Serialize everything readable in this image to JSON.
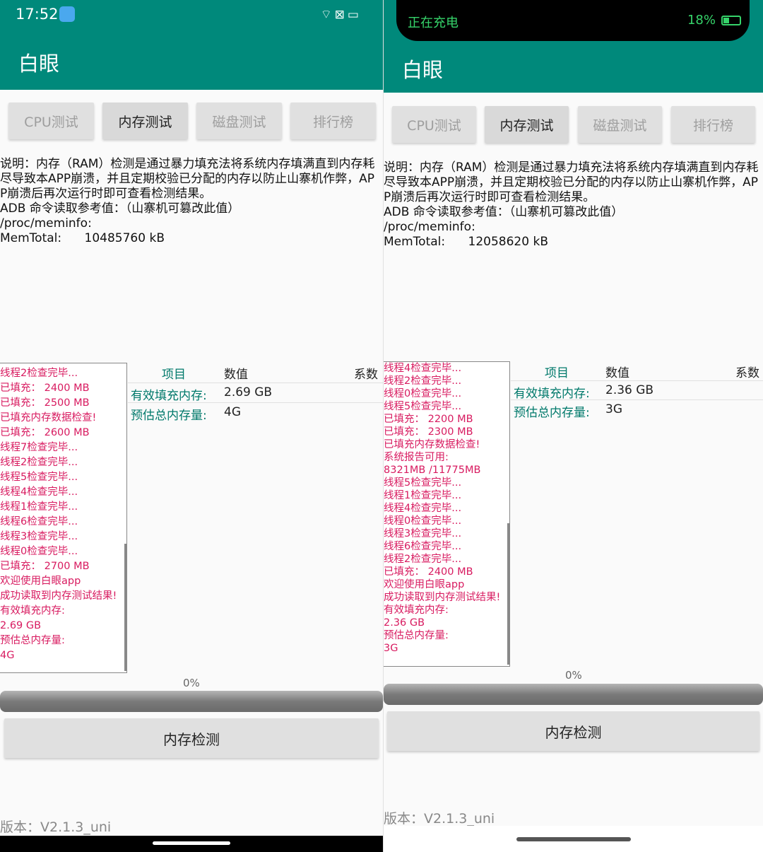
{
  "left": {
    "status": {
      "time": "17:52",
      "icons": "⌔⊠▭"
    },
    "app_title": "白眼",
    "tabs": [
      "CPU测试",
      "内存测试",
      "磁盘测试",
      "排行榜"
    ],
    "description": "说明：内存（RAM）检测是通过暴力填充法将系统内存填满直到内存耗尽导致本APP崩溃，并且定期校验已分配的内存以防止山寨机作弊，APP崩溃后再次运行时即可查看检测结果。\nADB 命令读取参考值：（山寨机可篡改此值）\n/proc/meminfo:\nMemTotal:      10485760 kB",
    "log": [
      "线程2检查完毕...",
      "已填充：  2400 MB",
      "已填充：  2500 MB",
      "已填充内存数据检查!",
      "已填充：  2600 MB",
      "线程7检查完毕...",
      "线程2检查完毕...",
      "线程5检查完毕...",
      "线程4检查完毕...",
      "线程1检查完毕...",
      "线程6检查完毕...",
      "线程3检查完毕...",
      "线程0检查完毕...",
      "已填充：  2700 MB",
      "欢迎使用白眼app",
      "成功读取到内存测试结果!",
      "有效填充内存:",
      "2.69 GB",
      "预估总内存量:",
      "4G"
    ],
    "table": {
      "headers": {
        "item": "项目",
        "value": "数值",
        "coef": "系数"
      },
      "rows": [
        {
          "key": "有效填充内存:",
          "value": "2.69 GB"
        },
        {
          "key": "预估总内存量:",
          "value": "4G"
        }
      ]
    },
    "progress_label": "0%",
    "progress_value": 0,
    "button": "内存检测",
    "version": "版本：V2.1.3_uni"
  },
  "right": {
    "status": {
      "charging": "正在充电",
      "battery": "18%"
    },
    "app_title": "白眼",
    "tabs": [
      "CPU测试",
      "内存测试",
      "磁盘测试",
      "排行榜"
    ],
    "description": "说明：内存（RAM）检测是通过暴力填充法将系统内存填满直到内存耗尽导致本APP崩溃，并且定期校验已分配的内存以防止山寨机作弊，APP崩溃后再次运行时即可查看检测结果。\nADB 命令读取参考值：（山寨机可篡改此值）\n/proc/meminfo:\nMemTotal:      12058620 kB",
    "log": [
      "线程4检查完毕...",
      "线程2检查完毕...",
      "线程0检查完毕...",
      "线程5检查完毕...",
      "已填充：  2200 MB",
      "已填充：  2300 MB",
      "已填充内存数据检查!",
      "系统报告可用:",
      "8321MB /11775MB",
      "线程5检查完毕...",
      "线程1检查完毕...",
      "线程4检查完毕...",
      "线程0检查完毕...",
      "线程3检查完毕...",
      "线程6检查完毕...",
      "线程2检查完毕...",
      "已填充：  2400 MB",
      "欢迎使用白眼app",
      "成功读取到内存测试结果!",
      "有效填充内存:",
      "2.36 GB",
      "预估总内存量:",
      "3G"
    ],
    "table": {
      "headers": {
        "item": "项目",
        "value": "数值",
        "coef": "系数"
      },
      "rows": [
        {
          "key": "有效填充内存:",
          "value": "2.36 GB"
        },
        {
          "key": "预估总内存量:",
          "value": "3G"
        }
      ]
    },
    "progress_label": "0%",
    "progress_value": 0,
    "button": "内存检测",
    "version": "版本：V2.1.3_uni"
  },
  "colors": {
    "appbar": "#00897b",
    "log_text": "#d81b60",
    "charging": "#36d36a"
  }
}
